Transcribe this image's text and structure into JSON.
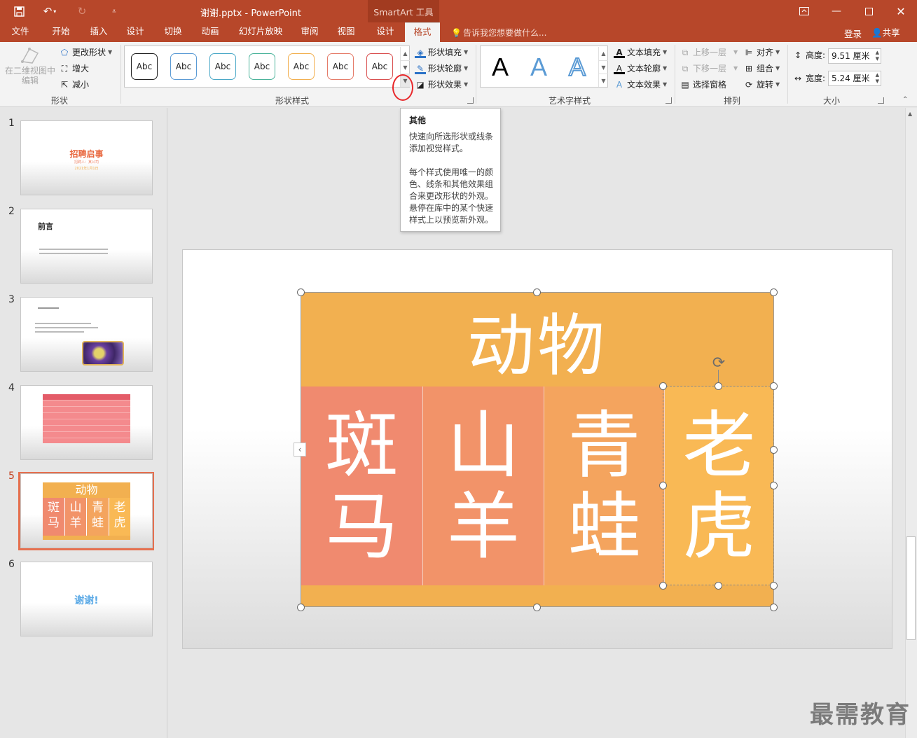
{
  "window": {
    "title": "谢谢.pptx - PowerPoint",
    "context_tool": "SmartArt 工具"
  },
  "tabs": [
    {
      "label": "文件"
    },
    {
      "label": "开始"
    },
    {
      "label": "插入"
    },
    {
      "label": "设计"
    },
    {
      "label": "切换"
    },
    {
      "label": "动画"
    },
    {
      "label": "幻灯片放映"
    },
    {
      "label": "审阅"
    },
    {
      "label": "视图"
    },
    {
      "label": "设计"
    },
    {
      "label": "格式"
    }
  ],
  "tell_me": "告诉我您想要做什么...",
  "login": "登录",
  "share": "共享",
  "ribbon": {
    "shapes": {
      "label": "形状",
      "edit_3d": "在二维视图中编辑",
      "change_shape": "更改形状",
      "larger": "增大",
      "smaller": "减小"
    },
    "shape_styles": {
      "label": "形状样式",
      "sample_text": "Abc",
      "styles": [
        {
          "color": "#222222"
        },
        {
          "color": "#5b9bd5"
        },
        {
          "color": "#4aa8c7"
        },
        {
          "color": "#4bb39b"
        },
        {
          "color": "#f2b050"
        },
        {
          "color": "#e57c6a"
        },
        {
          "color": "#d94f4f"
        }
      ],
      "fill": "形状填充",
      "outline": "形状轮廓",
      "effects": "形状效果"
    },
    "wordart": {
      "label": "艺术字样式",
      "sample": "A",
      "fill": "文本填充",
      "outline": "文本轮廓",
      "effects": "文本效果"
    },
    "arrange": {
      "label": "排列",
      "bring_forward": "上移一层",
      "send_backward": "下移一层",
      "selection_pane": "选择窗格",
      "align": "对齐",
      "group": "组合",
      "rotate": "旋转"
    },
    "size": {
      "label": "大小",
      "height_label": "高度:",
      "height_value": "9.51 厘米",
      "width_label": "宽度:",
      "width_value": "5.24 厘米"
    }
  },
  "tooltip": {
    "title": "其他",
    "line1": "快速向所选形状或线条添加视觉样式。",
    "line2": "每个样式使用唯一的颜色、线条和其他效果组合来更改形状的外观。悬停在库中的某个快速样式上以预览新外观。"
  },
  "thumbnails": [
    {
      "num": "1",
      "title": "招聘启事",
      "sub1": "招聘人：某公司",
      "sub2": "2021年1月1日"
    },
    {
      "num": "2",
      "title": "前言"
    },
    {
      "num": "3"
    },
    {
      "num": "4"
    },
    {
      "num": "5",
      "top": "动物",
      "cells": [
        "斑马",
        "山羊",
        "青蛙",
        "老虎"
      ]
    },
    {
      "num": "6",
      "title": "谢谢!"
    }
  ],
  "slide": {
    "header": "动物",
    "cells": [
      {
        "line1": "斑",
        "line2": "马",
        "color": "#f08a6f"
      },
      {
        "line1": "山",
        "line2": "羊",
        "color": "#f29369"
      },
      {
        "line1": "青",
        "line2": "蛙",
        "color": "#f4a45e"
      },
      {
        "line1": "老",
        "line2": "虎",
        "color": "#f9b955"
      }
    ]
  },
  "watermark": "最需教育"
}
